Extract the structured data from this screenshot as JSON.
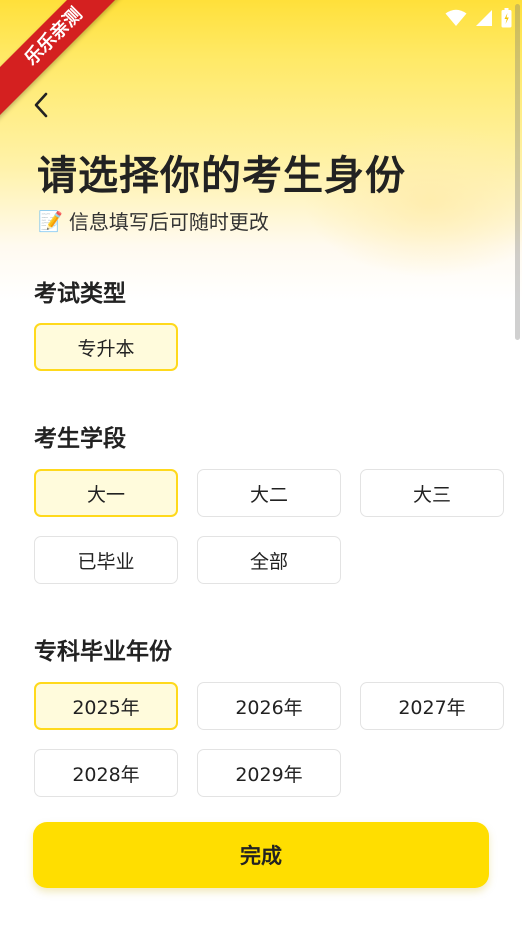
{
  "watermark": {
    "text": "乐乐亲测"
  },
  "status_bar": {
    "icons": [
      "wifi-icon",
      "cellular-signal-icon",
      "battery-icon"
    ]
  },
  "header": {
    "back_icon": "chevron-left-icon",
    "title": "请选择你的考生身份",
    "subtitle_emoji": "📝",
    "subtitle": "信息填写后可随时更改"
  },
  "sections": {
    "exam_type": {
      "title": "考试类型",
      "options": [
        {
          "label": "专升本",
          "selected": true
        }
      ]
    },
    "stage": {
      "title": "考生学段",
      "options": [
        {
          "label": "大一",
          "selected": true
        },
        {
          "label": "大二",
          "selected": false
        },
        {
          "label": "大三",
          "selected": false
        },
        {
          "label": "已毕业",
          "selected": false
        },
        {
          "label": "全部",
          "selected": false
        }
      ]
    },
    "grad_year": {
      "title": "专科毕业年份",
      "options": [
        {
          "label": "2025年",
          "selected": true
        },
        {
          "label": "2026年",
          "selected": false
        },
        {
          "label": "2027年",
          "selected": false
        },
        {
          "label": "2028年",
          "selected": false
        },
        {
          "label": "2029年",
          "selected": false
        }
      ]
    }
  },
  "footer": {
    "done_label": "完成"
  },
  "colors": {
    "accent": "#ffde00",
    "selected_border": "#ffd91c",
    "selected_fill": "#fffbdc",
    "watermark": "#d42020"
  }
}
